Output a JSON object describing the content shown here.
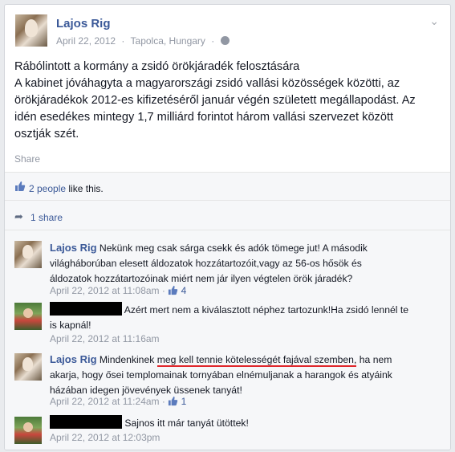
{
  "post": {
    "author": "Lajos Rig",
    "date": "April 22, 2012",
    "location": "Tapolca, Hungary",
    "lines": [
      "Rábólintott a kormány a zsidó örökjáradék felosztására",
      "A kabinet jóváhagyta a magyarországi zsidó vallási közösségek közötti, az",
      "örökjáradékok 2012-es kifizetéséről január végén született megállapodást. Az",
      "idén esedékes mintegy 1,7 milliárd forintot három vallási szervezet között",
      "osztják szét."
    ],
    "share_label": "Share"
  },
  "likes": {
    "people": "2 people",
    "suffix": "like this."
  },
  "shares": {
    "label": "1 share"
  },
  "comments": [
    {
      "author": "Lajos Rig",
      "lines": [
        "Nekünk meg csak sárga csekk és adók tömege jut! A második",
        "világháborúban elesett áldozatok hozzátartozóit,vagy az 56-os hősök és",
        "áldozatok hozzátartozóinak miért nem jár ilyen végtelen örök járadék?"
      ],
      "time": "April 22, 2012 at 11:08am",
      "like_count": "4"
    },
    {
      "author": "",
      "lines": [
        "Azért mert nem a kiválasztott néphez tartozunk!Ha zsidó lennél te",
        "is kapnál!"
      ],
      "time": "April 22, 2012 at 11:16am"
    },
    {
      "author": "Lajos Rig",
      "text_before": "Mindenkinek ",
      "text_underlined": "meg kell tennie kötelességét fajával szemben,",
      "text_after": " ha nem",
      "lines": [
        "akarja, hogy ősei templomainak tornyában elnémuljanak a harangok és atyáink",
        "házában idegen jövevények üssenek tanyát!"
      ],
      "time": "April 22, 2012 at 11:24am",
      "like_count": "1"
    },
    {
      "author": "",
      "lines": [
        "Sajnos itt már tanyát ütöttek!"
      ],
      "time": "April 22, 2012 at 12:03pm"
    }
  ],
  "colors": {
    "link": "#3b5998",
    "meta": "#9197a3",
    "underline": "#e0262b"
  }
}
